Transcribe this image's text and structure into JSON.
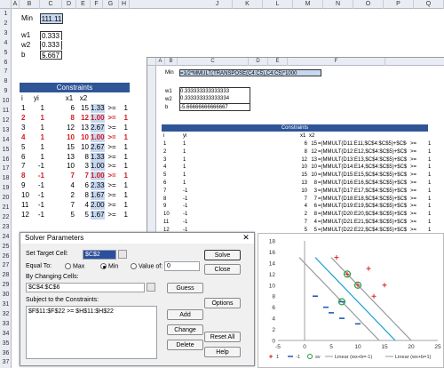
{
  "columns": [
    "A",
    "B",
    "C",
    "D",
    "E",
    "F",
    "G",
    "H"
  ],
  "more_columns": [
    "J",
    "K",
    "L",
    "M",
    "N",
    "O",
    "P",
    "Q"
  ],
  "row_numbers": [
    "1",
    "2",
    "3",
    "4",
    "5",
    "6",
    "7",
    "8",
    "9",
    "10",
    "11",
    "12",
    "13",
    "14",
    "15",
    "16",
    "17",
    "18",
    "19",
    "20",
    "21",
    "22",
    "23",
    "24",
    "25",
    "26",
    "27",
    "28",
    "29",
    "30",
    "31",
    "32",
    "33",
    "34",
    "35",
    "36",
    "37",
    "38"
  ],
  "params": {
    "min_label": "Min",
    "min_value": "111.11",
    "w1_label": "w1",
    "w1_value": "0.333",
    "w2_label": "w2",
    "w2_value": "0.333",
    "b_label": "b",
    "b_sign": "-",
    "b_value": "5.667"
  },
  "constraints": {
    "title": "Constraints",
    "headers": [
      "i",
      "yi",
      "x1",
      "x2"
    ],
    "rows": [
      {
        "i": "1",
        "yi": "1",
        "x1": "6",
        "x2": "15",
        "val": "1.33",
        "op": ">=",
        "rhs": "1",
        "red": false
      },
      {
        "i": "2",
        "yi": "1",
        "x1": "8",
        "x2": "12",
        "val": "1.00",
        "op": ">=",
        "rhs": "1",
        "red": true
      },
      {
        "i": "3",
        "yi": "1",
        "x1": "12",
        "x2": "13",
        "val": "2.67",
        "op": ">=",
        "rhs": "1",
        "red": false
      },
      {
        "i": "4",
        "yi": "1",
        "x1": "10",
        "x2": "10",
        "val": "1.00",
        "op": ">=",
        "rhs": "1",
        "red": true
      },
      {
        "i": "5",
        "yi": "1",
        "x1": "15",
        "x2": "10",
        "val": "2.67",
        "op": ">=",
        "rhs": "1",
        "red": false
      },
      {
        "i": "6",
        "yi": "1",
        "x1": "13",
        "x2": "8",
        "val": "1.33",
        "op": ">=",
        "rhs": "1",
        "red": false
      },
      {
        "i": "7",
        "yi": "-1",
        "x1": "10",
        "x2": "3",
        "val": "1.00",
        "op": ">=",
        "rhs": "1",
        "red": false
      },
      {
        "i": "8",
        "yi": "-1",
        "x1": "7",
        "x2": "7",
        "val": "1.00",
        "op": ">=",
        "rhs": "1",
        "red": true
      },
      {
        "i": "9",
        "yi": "-1",
        "x1": "4",
        "x2": "6",
        "val": "2.33",
        "op": ">=",
        "rhs": "1",
        "red": false
      },
      {
        "i": "10",
        "yi": "-1",
        "x1": "2",
        "x2": "8",
        "val": "1.67",
        "op": ">=",
        "rhs": "1",
        "red": false
      },
      {
        "i": "11",
        "yi": "-1",
        "x1": "7",
        "x2": "4",
        "val": "2.00",
        "op": ">=",
        "rhs": "1",
        "red": false
      },
      {
        "i": "12",
        "yi": "-1",
        "x1": "5",
        "x2": "5",
        "val": "1.67",
        "op": ">=",
        "rhs": "1",
        "red": false
      }
    ]
  },
  "formula_view": {
    "cols": [
      "A",
      "B",
      "C",
      "D",
      "E",
      "F"
    ],
    "min_label": "Min",
    "min_formula": "=1/2*MMULT(TRANSPOSE(C4:C5),C4:C5)*1000",
    "w1_label": "w1",
    "w1_value": "0.333333333333333",
    "w2_label": "w2",
    "w2_value": "0.333333333333334",
    "b_label": "b",
    "b_value": "-5.66666666666667",
    "title": "Constraints",
    "headers": [
      "i",
      "yi",
      "x1",
      "x2"
    ],
    "rows": [
      {
        "i": "1",
        "yi": "1",
        "x1": "6",
        "x2": "15",
        "f": "=(MMULT(D11:E11,$C$4:$C$5)+$C$6)*C11",
        "op": ">=",
        "rhs": "1"
      },
      {
        "i": "2",
        "yi": "1",
        "x1": "8",
        "x2": "12",
        "f": "=(MMULT(D12:E12,$C$4:$C$5)+$C$6)*C12",
        "op": ">=",
        "rhs": "1"
      },
      {
        "i": "3",
        "yi": "1",
        "x1": "12",
        "x2": "13",
        "f": "=(MMULT(D13:E13,$C$4:$C$5)+$C$6)*C13",
        "op": ">=",
        "rhs": "1"
      },
      {
        "i": "4",
        "yi": "1",
        "x1": "10",
        "x2": "10",
        "f": "=(MMULT(D14:E14,$C$4:$C$5)+$C$6)*C14",
        "op": ">=",
        "rhs": "1"
      },
      {
        "i": "5",
        "yi": "1",
        "x1": "15",
        "x2": "10",
        "f": "=(MMULT(D15:E15,$C$4:$C$5)+$C$6)*C15",
        "op": ">=",
        "rhs": "1"
      },
      {
        "i": "6",
        "yi": "1",
        "x1": "13",
        "x2": "8",
        "f": "=(MMULT(D16:E16,$C$4:$C$5)+$C$6)*C16",
        "op": ">=",
        "rhs": "1"
      },
      {
        "i": "7",
        "yi": "-1",
        "x1": "10",
        "x2": "3",
        "f": "=(MMULT(D17:E17,$C$4:$C$5)+$C$6)*C17",
        "op": ">=",
        "rhs": "1"
      },
      {
        "i": "8",
        "yi": "-1",
        "x1": "7",
        "x2": "7",
        "f": "=(MMULT(D18:E18,$C$4:$C$5)+$C$6)*C18",
        "op": ">=",
        "rhs": "1"
      },
      {
        "i": "9",
        "yi": "-1",
        "x1": "4",
        "x2": "6",
        "f": "=(MMULT(D19:E19,$C$4:$C$5)+$C$6)*C19",
        "op": ">=",
        "rhs": "1"
      },
      {
        "i": "10",
        "yi": "-1",
        "x1": "2",
        "x2": "8",
        "f": "=(MMULT(D20:E20,$C$4:$C$5)+$C$6)*C20",
        "op": ">=",
        "rhs": "1"
      },
      {
        "i": "11",
        "yi": "-1",
        "x1": "7",
        "x2": "4",
        "f": "=(MMULT(D21:E21,$C$4:$C$5)+$C$6)*C21",
        "op": ">=",
        "rhs": "1"
      },
      {
        "i": "12",
        "yi": "-1",
        "x1": "5",
        "x2": "5",
        "f": "=(MMULT(D22:E22,$C$4:$C$5)+$C$6)*C22",
        "op": ">=",
        "rhs": "1"
      }
    ]
  },
  "solver": {
    "title": "Solver Parameters",
    "target_label": "Set Target Cell:",
    "target_value": "$C$2",
    "equal_to_label": "Equal To:",
    "max_label": "Max",
    "min_label": "Min",
    "value_of_label": "Value of:",
    "value_of_value": "0",
    "changing_label": "By Changing Cells:",
    "changing_value": "$C$4:$C$6",
    "subject_label": "Subject to the Constraints:",
    "constraint_item": "$F$11:$F$22 >= $H$11:$H$22",
    "solve": "Solve",
    "close": "Close",
    "guess": "Guess",
    "options": "Options",
    "add": "Add",
    "change": "Change",
    "delete": "Delete",
    "reset_all": "Reset All",
    "help": "Help"
  },
  "chart_data": {
    "type": "scatter",
    "xlim": [
      -5,
      25
    ],
    "ylim": [
      0,
      18
    ],
    "xticks": [
      "-5",
      "0",
      "5",
      "10",
      "15",
      "20",
      "25"
    ],
    "yticks": [
      "0",
      "2",
      "4",
      "6",
      "8",
      "10",
      "12",
      "14",
      "16",
      "18"
    ],
    "series": [
      {
        "name": "1",
        "marker": "plus",
        "color": "#e02020",
        "x": [
          6,
          8,
          12,
          10,
          15,
          13
        ],
        "y": [
          15,
          12,
          13,
          10,
          10,
          8
        ]
      },
      {
        "name": "-1",
        "marker": "dash",
        "color": "#1f5fb4",
        "x": [
          10,
          7,
          4,
          2,
          7,
          5
        ],
        "y": [
          3,
          7,
          6,
          8,
          4,
          5
        ]
      },
      {
        "name": "sv",
        "marker": "circle",
        "color": "#1a9a3a",
        "x": [
          8,
          10,
          7
        ],
        "y": [
          12,
          10,
          7
        ]
      },
      {
        "name": "Linear (wx+b=-1)",
        "type": "line",
        "color": "#9a9a9a",
        "x": [
          -1,
          14
        ],
        "y": [
          15,
          0
        ]
      },
      {
        "name": "Linear (wx+b=0)",
        "type": "line",
        "color": "#1aa0d8",
        "x": [
          2,
          17
        ],
        "y": [
          15,
          0
        ]
      },
      {
        "name": "Linear (wx+b=1)",
        "type": "line",
        "color": "#9a9a9a",
        "x": [
          5,
          20
        ],
        "y": [
          15,
          0
        ]
      }
    ],
    "legend": [
      "1",
      "-1",
      "sv",
      "Linear (wx+b=-1)",
      "Linear (wx+b=1)"
    ]
  }
}
